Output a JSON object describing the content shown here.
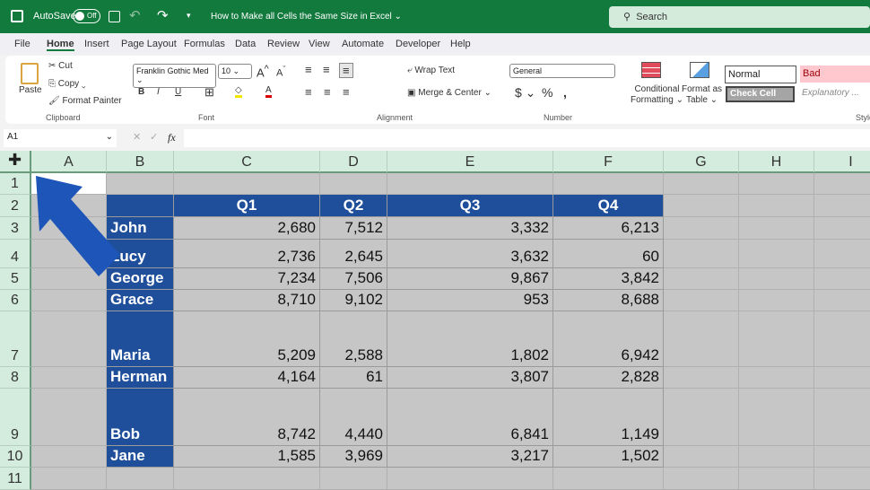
{
  "titlebar": {
    "autosave": "AutoSave",
    "toggle": "Off",
    "doc_title": "How to Make all Cells the Same Size in Excel",
    "search": "Search"
  },
  "menu": [
    "File",
    "Home",
    "Insert",
    "Page Layout",
    "Formulas",
    "Data",
    "Review",
    "View",
    "Automate",
    "Developer",
    "Help"
  ],
  "ribbon": {
    "paste": "Paste",
    "cut": "Cut",
    "copy": "Copy",
    "format_painter": "Format Painter",
    "clipboard": "Clipboard",
    "font_name": "Franklin Gothic Med",
    "font_size": "10",
    "font": "Font",
    "wrap_text": "Wrap Text",
    "merge_center": "Merge & Center",
    "alignment": "Alignment",
    "number_format": "General",
    "number": "Number",
    "conditional": "Conditional",
    "formatting": "Formatting",
    "format_as": "Format as",
    "table": "Table",
    "styles": "Styles",
    "style_normal": "Normal",
    "style_bad": "Bad",
    "style_check": "Check Cell",
    "style_explanatory": "Explanatory ...",
    "bold": "B",
    "italic": "I",
    "underline": "U"
  },
  "formula_bar": {
    "name_box": "A1",
    "fx": "fx",
    "value": ""
  },
  "columns": [
    "A",
    "B",
    "C",
    "D",
    "E",
    "F",
    "G",
    "H",
    "I"
  ],
  "rows": [
    "1",
    "2",
    "3",
    "4",
    "5",
    "6",
    "7",
    "8",
    "9",
    "10",
    "11"
  ],
  "table": {
    "headers": [
      "Q1",
      "Q2",
      "Q3",
      "Q4"
    ],
    "rows": [
      {
        "name": "John",
        "values": [
          "2,680",
          "7,512",
          "3,332",
          "6,213"
        ]
      },
      {
        "name": "Lucy",
        "values": [
          "2,736",
          "2,645",
          "3,632",
          "60"
        ]
      },
      {
        "name": "George",
        "values": [
          "7,234",
          "7,506",
          "9,867",
          "3,842"
        ]
      },
      {
        "name": "Grace",
        "values": [
          "8,710",
          "9,102",
          "953",
          "8,688"
        ]
      },
      {
        "name": "Maria",
        "values": [
          "5,209",
          "2,588",
          "1,802",
          "6,942"
        ]
      },
      {
        "name": "Herman",
        "values": [
          "4,164",
          "61",
          "3,807",
          "2,828"
        ]
      },
      {
        "name": "Bob",
        "values": [
          "8,742",
          "4,440",
          "6,841",
          "1,149"
        ]
      },
      {
        "name": "Jane",
        "values": [
          "1,585",
          "3,969",
          "3,217",
          "1,502"
        ]
      }
    ]
  },
  "colors": {
    "title": "#137a3e",
    "table_blue": "#1f4e9b",
    "arrow": "#1d55b8",
    "header": "#d3ecdd"
  }
}
